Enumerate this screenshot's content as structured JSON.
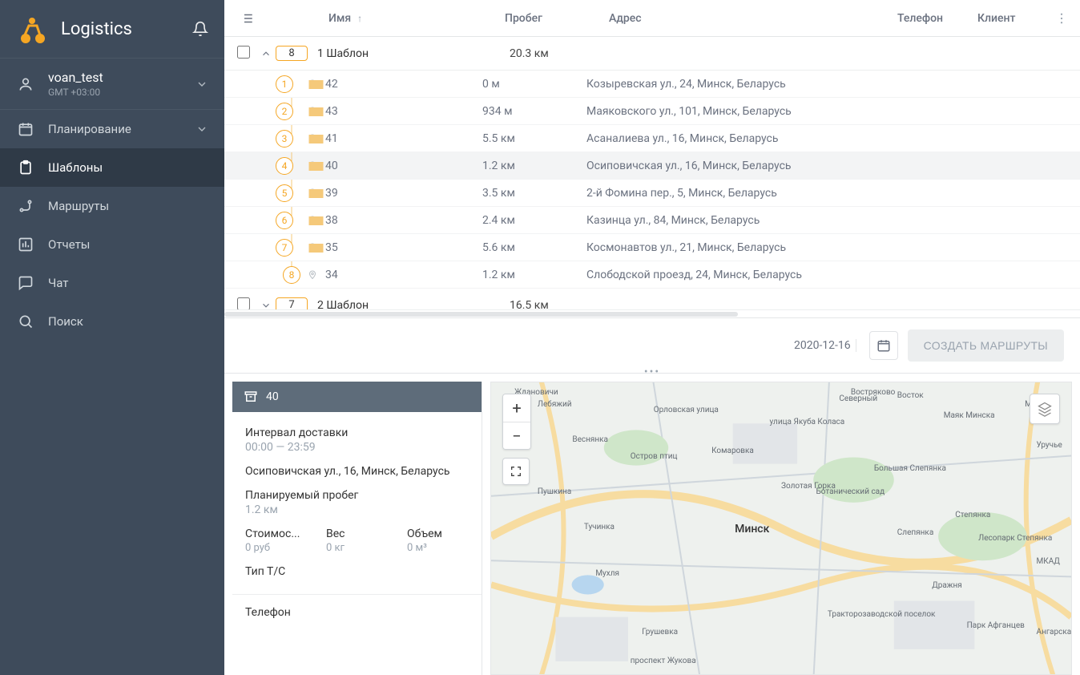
{
  "app": {
    "title": "Logistics"
  },
  "user": {
    "name": "voan_test",
    "tz": "GMT +03:00"
  },
  "nav": {
    "planning": "Планирование",
    "templates": "Шаблоны",
    "routes": "Маршруты",
    "reports": "Отчеты",
    "chat": "Чат",
    "search": "Поиск"
  },
  "table": {
    "headers": {
      "name": "Имя",
      "run": "Пробег",
      "addr": "Адрес",
      "phone": "Телефон",
      "client": "Клиент"
    },
    "groups": [
      {
        "badge": "8",
        "name": "1 Шаблон",
        "run": "20.3 км",
        "expanded": true
      },
      {
        "badge": "7",
        "name": "2 Шаблон",
        "run": "16.5 км",
        "expanded": false
      }
    ],
    "items": [
      {
        "ord": "1",
        "name": "42",
        "run": "0 м",
        "addr": "Козыревская ул., 24, Минск, Беларусь"
      },
      {
        "ord": "2",
        "name": "43",
        "run": "934 м",
        "addr": "Маяковского ул., 101, Минск, Беларусь"
      },
      {
        "ord": "3",
        "name": "41",
        "run": "5.5 км",
        "addr": "Асаналиева ул., 16, Минск, Беларусь"
      },
      {
        "ord": "4",
        "name": "40",
        "run": "1.2 км",
        "addr": "Осиповичская ул., 16, Минск, Беларусь"
      },
      {
        "ord": "5",
        "name": "39",
        "run": "3.5 км",
        "addr": "2-й Фомина пер., 5, Минск, Беларусь"
      },
      {
        "ord": "6",
        "name": "38",
        "run": "2.4 км",
        "addr": "Казинца ул., 84, Минск, Беларусь"
      },
      {
        "ord": "7",
        "name": "35",
        "run": "5.6 км",
        "addr": "Космонавтов ул., 21, Минск, Беларусь"
      },
      {
        "ord": "8",
        "name": "34",
        "run": "1.2 км",
        "addr": "Слободской проезд, 24, Минск, Беларусь"
      }
    ],
    "highlighted_index": 3
  },
  "footer": {
    "date": "2020-12-16",
    "create": "СОЗДАТЬ МАРШРУТЫ"
  },
  "detail": {
    "title": "40",
    "interval_label": "Интервал доставки",
    "interval_value": "00:00 — 23:59",
    "address": "Осиповичская ул., 16, Минск, Беларусь",
    "planned_label": "Планируемый пробег",
    "planned_value": "1.2 км",
    "cost_label": "Стоимос...",
    "cost_value": "0 руб",
    "weight_label": "Вес",
    "weight_value": "0 кг",
    "volume_label": "Объем",
    "volume_value": "0 м³",
    "vtype_label": "Тип Т/С",
    "phone_label": "Телефон"
  },
  "map": {
    "city": "Минск",
    "labels": [
      "Лебяжий",
      "Веснянка",
      "Орловская улица",
      "Остров птиц",
      "Комаровка",
      "улица Якуба Коласа",
      "Золотая Горка",
      "Востряково",
      "Восток",
      "МКАД",
      "Маяк Минска",
      "Уручье",
      "Большая Слепянка",
      "Ботанический сад",
      "Степянка",
      "Лесопарк Степянка",
      "МКАД",
      "Дражня",
      "Парк Афганцев",
      "Ангарская",
      "Тракторозаводской поселок",
      "Грушевка",
      "Мухля",
      "Тучинка",
      "Пушкина",
      "проспект Жукова",
      "Слепянка",
      "Северный",
      "Ждановичи"
    ]
  }
}
